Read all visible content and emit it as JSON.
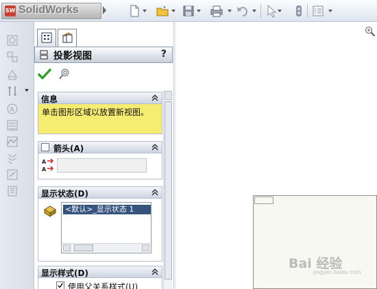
{
  "app": {
    "logo_badge": "SW",
    "logo_text": "SolidWorks"
  },
  "toolbar": {
    "icons": [
      "new-document-icon",
      "open-folder-icon",
      "save-icon",
      "print-icon",
      "undo-icon",
      "select-arrow-icon",
      "rebuild-traffic-light-icon",
      "options-list-icon"
    ]
  },
  "left_toolbar": {
    "icons": [
      "model-view-icon",
      "projected-view-icon",
      "auxiliary-view-icon",
      "section-view-icon",
      "detail-view-icon",
      "broken-out-section-icon",
      "break-icon",
      "crop-view-icon",
      "alternate-position-icon",
      "relative-view-icon"
    ]
  },
  "panel": {
    "tabs": [
      "property-manager-tab",
      "drawing-view-tab"
    ],
    "title": "投影视图",
    "help": "?",
    "info": {
      "title": "信息",
      "text": "单击图形区域以放置新视图。"
    },
    "arrow_group": {
      "title": "箭头(A)",
      "label_value": ""
    },
    "display_state": {
      "title": "显示状态(D)",
      "items": [
        "<默认>_显示状态 1"
      ]
    },
    "display_style": {
      "title": "显示样式(D)",
      "option_label": "使用父关系样式(U)"
    }
  },
  "watermark": {
    "text": "Bai 经验",
    "sub": "jingyan.baidu.com"
  },
  "colors": {
    "info_bg": "#f5ec72",
    "selected_item": "#36537e",
    "ok_check": "#2f9e2f"
  }
}
